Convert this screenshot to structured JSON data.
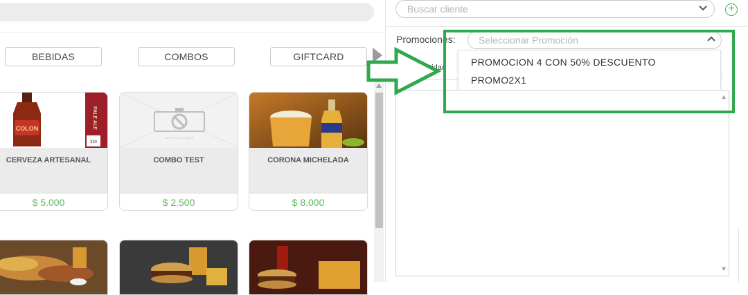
{
  "categories": [
    {
      "label": "BEBIDAS"
    },
    {
      "label": "COMBOS"
    },
    {
      "label": "GIFTCARD"
    }
  ],
  "products": [
    {
      "name": "CERVEZA ARTESANAL",
      "price": "$ 5.000"
    },
    {
      "name": "COMBO TEST",
      "price": "$ 2.500"
    },
    {
      "name": "CORONA MICHELADA",
      "price": "$ 8.000"
    }
  ],
  "images": {
    "bottle_label": "COLON",
    "side_label": "PALE ALE",
    "side_volume": "330",
    "placeholder_caption": "NO PRODUCT IMAGE"
  },
  "client": {
    "placeholder": "Buscar cliente"
  },
  "promotions": {
    "label": "Promociones:",
    "placeholder": "Seleccionar Promoción",
    "options": [
      "PROMOCION 4 CON 50% DESCUENTO",
      "PROMO2X1"
    ]
  },
  "table": {
    "quantity_header": "Cantidad"
  },
  "colors": {
    "accent_green": "#2fa84f",
    "price_green": "#5cb85c"
  },
  "icons": [
    "chevron-down-icon",
    "chevron-up-icon",
    "plus-circle-icon",
    "arrow-right-icon",
    "scroll-next-icon"
  ]
}
